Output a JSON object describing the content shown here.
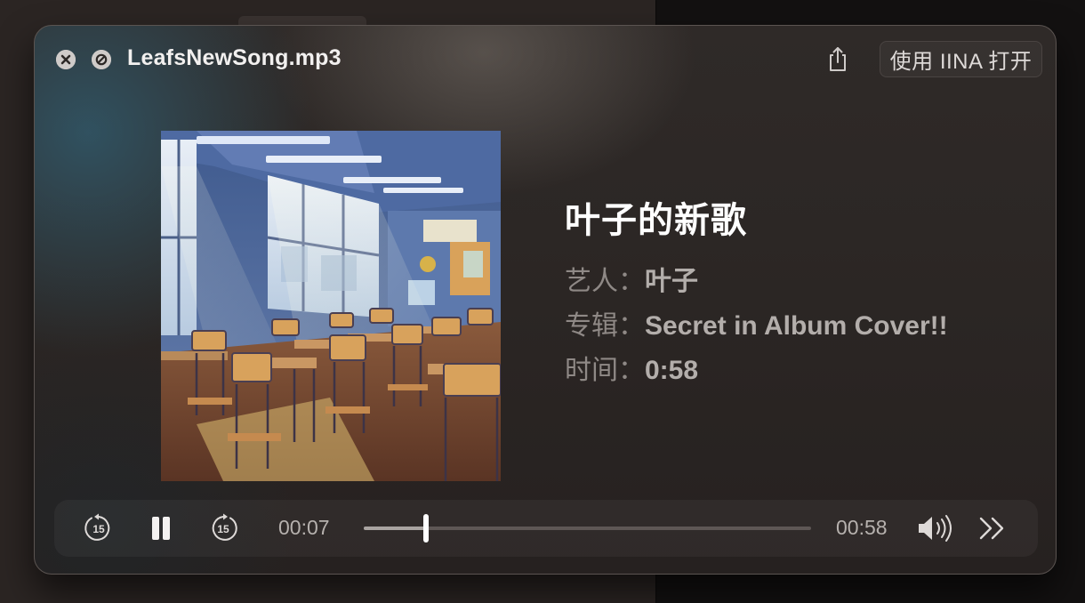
{
  "window": {
    "filename": "LeafsNewSong.mp3",
    "open_button_label": "使用 IINA 打开"
  },
  "track": {
    "title": "叶子的新歌",
    "artist_label": "艺人：",
    "artist": "叶子",
    "album_label": "专辑：",
    "album": "Secret in Album Cover!!",
    "duration_label": "时间：",
    "duration": "0:58"
  },
  "player": {
    "current_time": "00:07",
    "total_time": "00:58",
    "progress_fraction": 0.14,
    "skip_back_seconds": "15",
    "skip_forward_seconds": "15",
    "state": "playing"
  },
  "icons": {
    "close": "close-icon",
    "stop": "stop-icon",
    "share": "share-icon",
    "skip_back": "skip-back-15-icon",
    "pause": "pause-icon",
    "skip_forward": "skip-forward-15-icon",
    "volume": "speaker-volume-icon",
    "more": "chevron-double-right-icon"
  },
  "colors": {
    "accent_text": "#ffffff",
    "secondary_text": "#8f8986",
    "progress_fill": "#a9a4a1"
  }
}
